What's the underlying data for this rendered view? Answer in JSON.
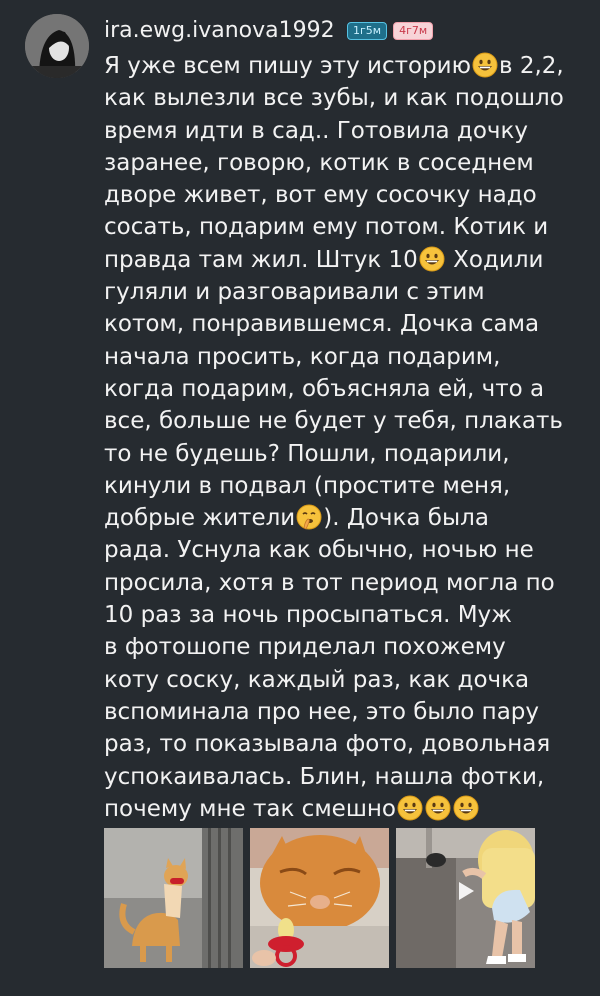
{
  "post": {
    "username": "ira.ewg.ivanova1992",
    "badges": [
      "1г5м",
      "4г7м"
    ],
    "lines": [
      "Я уже всем пишу эту историю",
      "в 2,2,",
      "как вылезли все зубы, и как подошло",
      "время идти в сад.. Готовила дочку",
      "заранее, говорю, котик в соседнем",
      "дворе живет, вот  ему сосочку надо",
      "сосать, подарим ему потом. Котик и",
      "правда там жил. Штук 10",
      " Ходили",
      "гуляли и разговаривали с этим",
      "котом, понравившемся. Дочка сама",
      "начала просить, когда подарим,",
      "когда подарим, объясняла ей, что а",
      "все, больше не будет у тебя, плакать",
      "то не будешь? Пошли, подарили,",
      "кинули в подвал (простите меня,",
      "добрые жители",
      "). Дочка была",
      "рада. Уснула как обычно, ночью не",
      "просила, хотя в тот период могла по",
      "10 раз за ночь просыпаться. Муж",
      "в фотошопе приделал похожему",
      "коту соску, каждый раз, как дочка",
      "вспоминала про нее, это было пару",
      "раз, то показывала фото, довольная",
      "успокаивалась. Блин, нашла фотки,",
      "почему мне так смешно"
    ]
  },
  "icons": {
    "grin": "grinning-face-emoji",
    "shush": "shushing-face-emoji",
    "avatar": "avatar",
    "play": "play-icon"
  },
  "colors": {
    "background": "#262b30",
    "text": "#f2f2f2",
    "badge_blue": "#1f6f8a",
    "badge_pink": "#f7d3d7"
  }
}
